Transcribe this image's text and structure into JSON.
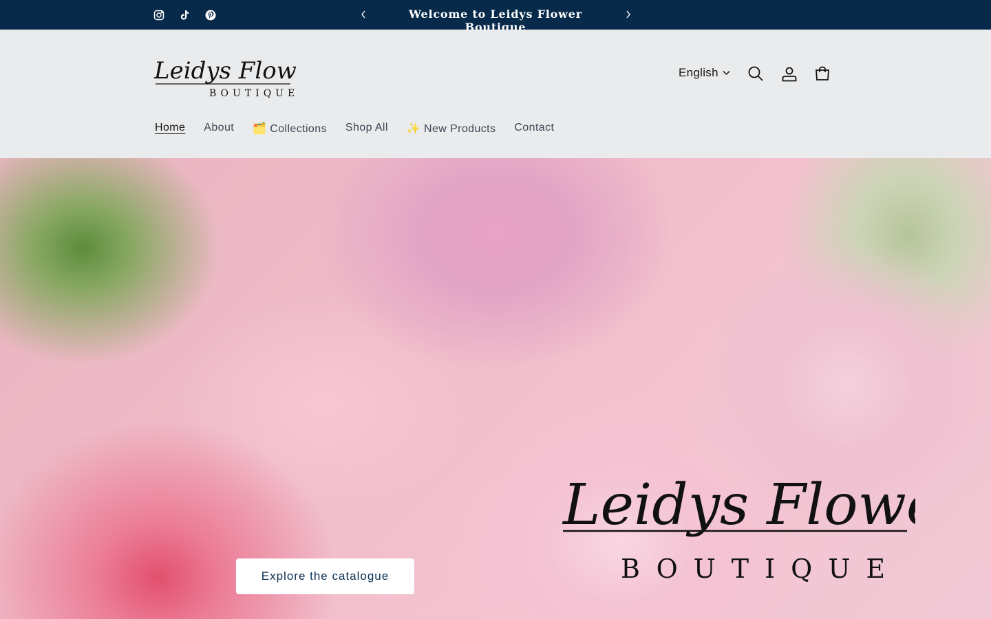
{
  "announcement": {
    "text": "Welcome to Leidys Flower Boutique",
    "bg_color": "#082a4a",
    "prev_icon": "chevron-left-icon",
    "next_icon": "chevron-right-icon"
  },
  "social": [
    {
      "name": "instagram-icon",
      "label": "Instagram"
    },
    {
      "name": "tiktok-icon",
      "label": "TikTok"
    },
    {
      "name": "pinterest-icon",
      "label": "Pinterest"
    }
  ],
  "header": {
    "logo_script": "Leidys Flower",
    "logo_sub": "BOUTIQUE",
    "language": "English",
    "icons": [
      "search-icon",
      "account-icon",
      "cart-icon"
    ]
  },
  "nav": {
    "items": [
      {
        "label": "Home",
        "active": true
      },
      {
        "label": "About"
      },
      {
        "label": "🗂️ Collections"
      },
      {
        "label": "Shop All"
      },
      {
        "label": "✨ New Products"
      },
      {
        "label": "Contact"
      }
    ]
  },
  "hero": {
    "logo_script": "Leidys Flower",
    "logo_sub": "BOUTIQUE",
    "cta_label": "Explore the catalogue"
  }
}
